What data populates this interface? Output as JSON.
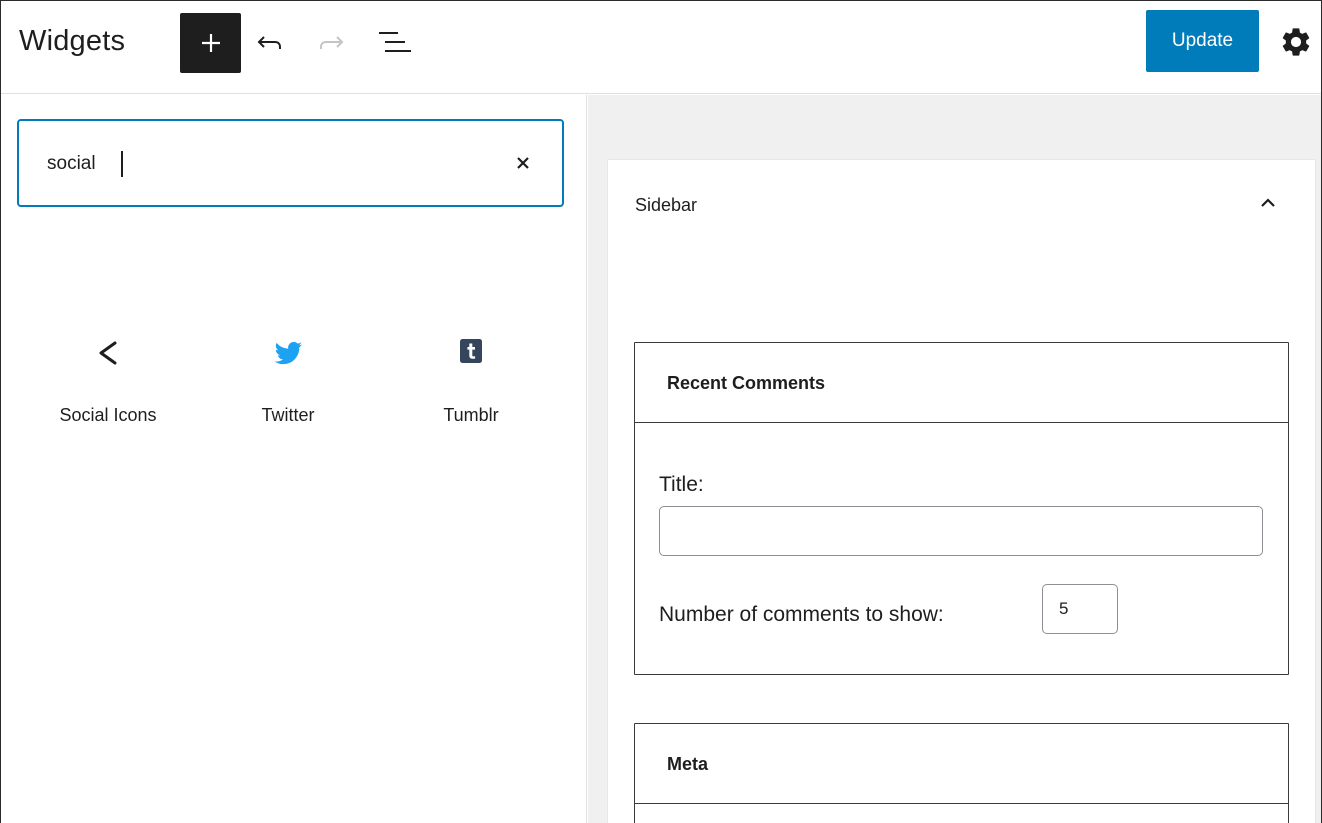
{
  "header": {
    "title": "Widgets",
    "update_label": "Update",
    "icons": {
      "inserter": "plus-icon",
      "undo": "undo-icon",
      "redo": "redo-icon",
      "list_view": "list-view-icon",
      "settings": "gear-icon"
    }
  },
  "inserter": {
    "search_value": "social",
    "results": [
      {
        "label": "Social Icons",
        "icon": "share-icon"
      },
      {
        "label": "Twitter",
        "icon": "twitter-icon"
      },
      {
        "label": "Tumblr",
        "icon": "tumblr-icon"
      }
    ]
  },
  "sidebar": {
    "title": "Sidebar",
    "widgets": [
      {
        "title": "Recent Comments",
        "title_field_label": "Title:",
        "title_field_value": "",
        "count_label": "Number of comments to show:",
        "count_value": "5"
      },
      {
        "title": "Meta"
      }
    ]
  },
  "colors": {
    "accent": "#007cba",
    "twitter": "#1da1f2",
    "tumblr": "#35465c",
    "dark": "#1e1e1e",
    "canvas_bg": "#f0f0f0"
  }
}
